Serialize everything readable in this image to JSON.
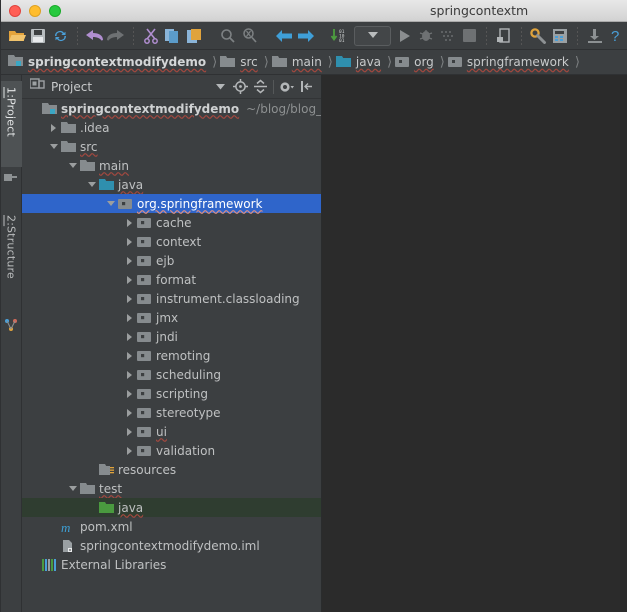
{
  "window": {
    "title": "springcontextm",
    "traffic_lights": [
      "close-red",
      "minimize-yellow",
      "maximize-green"
    ]
  },
  "toolbar": {
    "items": [
      {
        "name": "open-folder-icon",
        "label": "Open"
      },
      {
        "name": "save-all-icon",
        "label": "Save All"
      },
      {
        "name": "sync-refresh-icon",
        "label": "Synchronize"
      },
      {
        "name": "undo-icon",
        "label": "Undo"
      },
      {
        "name": "redo-icon",
        "label": "Redo"
      },
      {
        "name": "cut-icon",
        "label": "Cut"
      },
      {
        "name": "copy-icon",
        "label": "Copy"
      },
      {
        "name": "paste-icon",
        "label": "Paste"
      },
      {
        "name": "find-icon",
        "label": "Find"
      },
      {
        "name": "replace-icon",
        "label": "Replace"
      },
      {
        "name": "back-arrow-icon",
        "label": "Back"
      },
      {
        "name": "forward-arrow-icon",
        "label": "Forward"
      },
      {
        "name": "compile-icon",
        "label": "Compile"
      },
      {
        "name": "run-configuration-dropdown",
        "label": "Select Run/Debug Configuration"
      },
      {
        "name": "run-icon",
        "label": "Run"
      },
      {
        "name": "debug-icon",
        "label": "Debug"
      },
      {
        "name": "coverage-icon",
        "label": "Run with Coverage"
      },
      {
        "name": "stop-icon",
        "label": "Stop"
      },
      {
        "name": "update-app-icon",
        "label": "Update Application"
      },
      {
        "name": "settings-icon",
        "label": "Settings"
      },
      {
        "name": "project-structure-icon",
        "label": "Project Structure"
      },
      {
        "name": "sdk-icon",
        "label": "SDK"
      },
      {
        "name": "help-icon",
        "label": "Help"
      }
    ]
  },
  "breadcrumb": {
    "items": [
      {
        "label": "springcontextmodifydemo",
        "icon": "project-module-icon"
      },
      {
        "label": "src",
        "icon": "folder-icon"
      },
      {
        "label": "main",
        "icon": "folder-icon"
      },
      {
        "label": "java",
        "icon": "source-folder-icon"
      },
      {
        "label": "org",
        "icon": "package-icon"
      },
      {
        "label": "springframework",
        "icon": "package-icon"
      }
    ]
  },
  "tool_tabs": [
    {
      "label_num": "1:",
      "label": " Project",
      "icon": "project-icon",
      "active": true
    },
    {
      "label_num": "2:",
      "label": " Structure",
      "icon": "structure-icon",
      "active": false
    }
  ],
  "project_panel": {
    "title": "Project",
    "title_icon": "project-view-icon",
    "buttons": [
      {
        "name": "view-mode-chevron-icon",
        "label": "Project view mode"
      },
      {
        "name": "scroll-from-source-icon",
        "label": "Select Opened File"
      },
      {
        "name": "collapse-all-icon",
        "label": "Collapse All"
      },
      {
        "name": "settings-gear-icon",
        "label": "Show Options Menu"
      },
      {
        "name": "hide-panel-icon",
        "label": "Hide"
      }
    ]
  },
  "tree": {
    "rows": [
      {
        "depth": 0,
        "twisty": "none",
        "icon": "project-module-icon",
        "label": "springcontextmodifydemo",
        "bold": true,
        "wavy": true,
        "suffix": "~/blog/blog_c",
        "state": "normal"
      },
      {
        "depth": 1,
        "twisty": "collapsed",
        "icon": "folder-icon",
        "label": ".idea",
        "bold": false,
        "wavy": false,
        "suffix": "",
        "state": "normal"
      },
      {
        "depth": 1,
        "twisty": "expanded",
        "icon": "folder-icon",
        "label": "src",
        "bold": false,
        "wavy": true,
        "suffix": "",
        "state": "normal"
      },
      {
        "depth": 2,
        "twisty": "expanded",
        "icon": "folder-icon",
        "label": "main",
        "bold": false,
        "wavy": true,
        "suffix": "",
        "state": "normal"
      },
      {
        "depth": 3,
        "twisty": "expanded",
        "icon": "source-folder-icon",
        "label": "java",
        "bold": false,
        "wavy": true,
        "suffix": "",
        "state": "normal"
      },
      {
        "depth": 4,
        "twisty": "expanded",
        "icon": "package-icon",
        "label": "org.springframework",
        "bold": false,
        "wavy": true,
        "suffix": "",
        "state": "selected"
      },
      {
        "depth": 5,
        "twisty": "collapsed",
        "icon": "package-icon",
        "label": "cache",
        "bold": false,
        "wavy": false,
        "suffix": "",
        "state": "normal"
      },
      {
        "depth": 5,
        "twisty": "collapsed",
        "icon": "package-icon",
        "label": "context",
        "bold": false,
        "wavy": false,
        "suffix": "",
        "state": "normal"
      },
      {
        "depth": 5,
        "twisty": "collapsed",
        "icon": "package-icon",
        "label": "ejb",
        "bold": false,
        "wavy": false,
        "suffix": "",
        "state": "normal"
      },
      {
        "depth": 5,
        "twisty": "collapsed",
        "icon": "package-icon",
        "label": "format",
        "bold": false,
        "wavy": false,
        "suffix": "",
        "state": "normal"
      },
      {
        "depth": 5,
        "twisty": "collapsed",
        "icon": "package-icon",
        "label": "instrument.classloading",
        "bold": false,
        "wavy": false,
        "suffix": "",
        "state": "normal"
      },
      {
        "depth": 5,
        "twisty": "collapsed",
        "icon": "package-icon",
        "label": "jmx",
        "bold": false,
        "wavy": false,
        "suffix": "",
        "state": "normal"
      },
      {
        "depth": 5,
        "twisty": "collapsed",
        "icon": "package-icon",
        "label": "jndi",
        "bold": false,
        "wavy": false,
        "suffix": "",
        "state": "normal"
      },
      {
        "depth": 5,
        "twisty": "collapsed",
        "icon": "package-icon",
        "label": "remoting",
        "bold": false,
        "wavy": false,
        "suffix": "",
        "state": "normal"
      },
      {
        "depth": 5,
        "twisty": "collapsed",
        "icon": "package-icon",
        "label": "scheduling",
        "bold": false,
        "wavy": false,
        "suffix": "",
        "state": "normal"
      },
      {
        "depth": 5,
        "twisty": "collapsed",
        "icon": "package-icon",
        "label": "scripting",
        "bold": false,
        "wavy": false,
        "suffix": "",
        "state": "normal"
      },
      {
        "depth": 5,
        "twisty": "collapsed",
        "icon": "package-icon",
        "label": "stereotype",
        "bold": false,
        "wavy": false,
        "suffix": "",
        "state": "normal"
      },
      {
        "depth": 5,
        "twisty": "collapsed",
        "icon": "package-icon",
        "label": "ui",
        "bold": false,
        "wavy": true,
        "suffix": "",
        "state": "normal"
      },
      {
        "depth": 5,
        "twisty": "collapsed",
        "icon": "package-icon",
        "label": "validation",
        "bold": false,
        "wavy": false,
        "suffix": "",
        "state": "normal"
      },
      {
        "depth": 3,
        "twisty": "none",
        "icon": "resources-folder-icon",
        "label": "resources",
        "bold": false,
        "wavy": false,
        "suffix": "",
        "state": "normal"
      },
      {
        "depth": 2,
        "twisty": "expanded",
        "icon": "folder-icon",
        "label": "test",
        "bold": false,
        "wavy": true,
        "suffix": "",
        "state": "normal"
      },
      {
        "depth": 3,
        "twisty": "none",
        "icon": "test-source-folder-icon",
        "label": "java",
        "bold": false,
        "wavy": true,
        "suffix": "",
        "state": "greenhl"
      },
      {
        "depth": 1,
        "twisty": "none",
        "icon": "maven-pom-icon",
        "label": "pom.xml",
        "bold": false,
        "wavy": false,
        "suffix": "",
        "state": "normal"
      },
      {
        "depth": 1,
        "twisty": "none",
        "icon": "iml-module-icon",
        "label": "springcontextmodifydemo.iml",
        "bold": false,
        "wavy": false,
        "suffix": "",
        "state": "normal"
      },
      {
        "depth": 0,
        "twisty": "none",
        "icon": "external-libraries-icon",
        "label": "External Libraries",
        "bold": false,
        "wavy": false,
        "suffix": "",
        "state": "normal"
      }
    ]
  },
  "colors": {
    "panel_bg": "#3c3f41",
    "editor_bg": "#2b2b2b",
    "selection_blue": "#2f65ca",
    "green_highlight": "#2f3d30",
    "text": "#bfc1c2",
    "folder_gray": "#9aa0a6",
    "source_teal": "#3b8ba5",
    "test_green": "#4a9a3f"
  }
}
